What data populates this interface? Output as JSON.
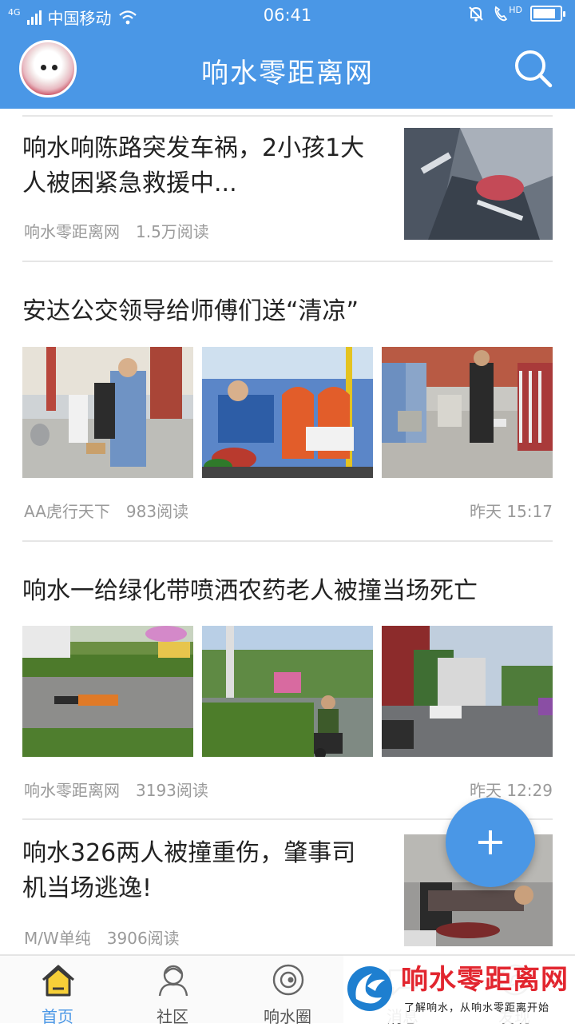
{
  "status": {
    "network": "4G",
    "carrier": "中国移动",
    "time": "06:41",
    "hd": "HD",
    "battery_level": 0.85
  },
  "header": {
    "title": "响水零距离网"
  },
  "colors": {
    "brand": "#4a97e6",
    "text": "#222222",
    "meta": "#9a9a9a"
  },
  "articles": [
    {
      "title_line1": "响水响陈路突发车祸，2小孩1大",
      "title_line2": "人被困紧急救援中...",
      "source": "响水零距离网",
      "reads": "1.5万阅读",
      "time": ""
    },
    {
      "title_line1": "安达公交领导给师傅们送“清凉”",
      "source": "AA虎行天下",
      "reads": "983阅读",
      "time": "昨天 15:17"
    },
    {
      "title_line1": "响水一给绿化带喷洒农药老人被撞当场死亡",
      "source": "响水零距离网",
      "reads": "3193阅读",
      "time": "昨天 12:29"
    },
    {
      "title_line1": "响水326两人被撞重伤，肇事司",
      "title_line2": "机当场逃逸!",
      "source": "M/W单纯",
      "reads": "3906阅读",
      "time": ""
    }
  ],
  "tabs": [
    {
      "label": "首页",
      "icon": "home-icon"
    },
    {
      "label": "社区",
      "icon": "community-icon"
    },
    {
      "label": "响水圈",
      "icon": "circle-icon"
    },
    {
      "label": "消息",
      "icon": "message-icon"
    },
    {
      "label": "发现",
      "icon": "discover-icon"
    }
  ],
  "watermark": {
    "title": "响水零距离网",
    "subtitle": "了解响水，从响水零距离开始"
  }
}
